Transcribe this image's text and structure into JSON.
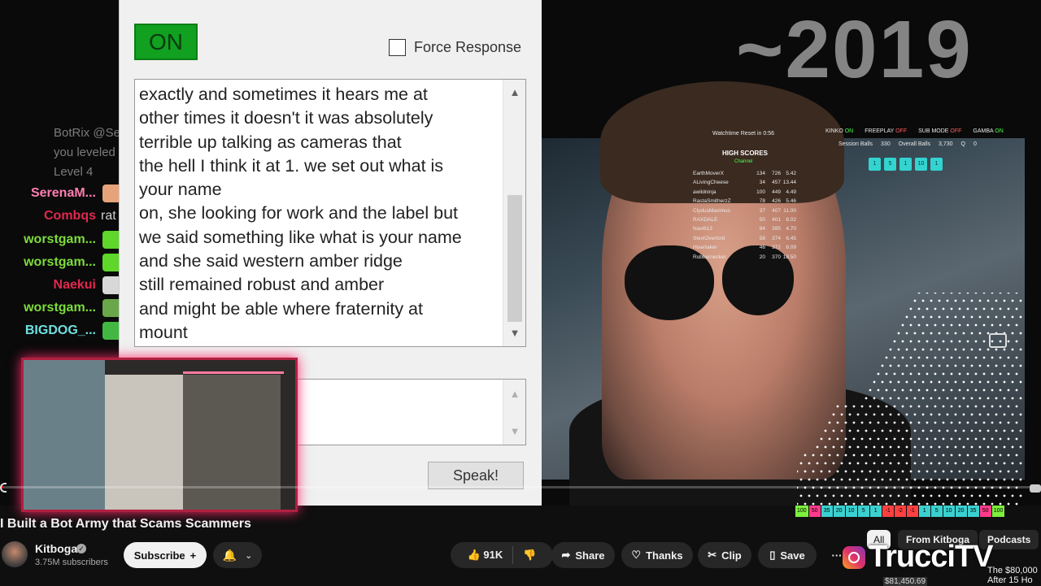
{
  "overlay": {
    "year": "~2019",
    "watchtime": "Watchtime Reset in 0:56",
    "modes": [
      {
        "label": "KINKO",
        "state": "ON"
      },
      {
        "label": "FREEPLAY",
        "state": "OFF"
      },
      {
        "label": "SUB MODE",
        "state": "OFF"
      },
      {
        "label": "GAMBA",
        "state": "ON"
      }
    ],
    "balls": {
      "session_label": "Session Balls",
      "session": "330",
      "overall_label": "Overall Balls",
      "overall": "3,730",
      "q_label": "Q",
      "q": "0"
    },
    "ball_boxes": [
      "1",
      "5",
      "1",
      "10",
      "1"
    ],
    "high_scores_title": "HIGH SCORES",
    "high_scores_sub": "Channel",
    "high_scores": [
      [
        "EarthMoverX",
        "134",
        "726",
        "5.42"
      ],
      [
        "ALivingCheese",
        "34",
        "457",
        "13.44"
      ],
      [
        "awildninja",
        "100",
        "449",
        "4.49"
      ],
      [
        "RastaSmitherzZ",
        "78",
        "426",
        "5.46"
      ],
      [
        "ClydusMaximus",
        "37",
        "407",
        "11.00"
      ],
      [
        "RAXDALE",
        "50",
        "401",
        "8.02"
      ],
      [
        "Navi613",
        "84",
        "395",
        "4.70"
      ],
      [
        "SteviOverlord",
        "58",
        "374",
        "6.45"
      ],
      [
        "Hisertaker",
        "46",
        "372",
        "8.09"
      ],
      [
        "Rubbernecker",
        "20",
        "370",
        "18.50"
      ]
    ],
    "meter": [
      {
        "v": "100",
        "c": "#7cf03c"
      },
      {
        "v": "50",
        "c": "#ff3b8b"
      },
      {
        "v": "35",
        "c": "#3ad0d0"
      },
      {
        "v": "20",
        "c": "#3ad0d0"
      },
      {
        "v": "10",
        "c": "#3ad0d0"
      },
      {
        "v": "5",
        "c": "#3ad0d0"
      },
      {
        "v": "1",
        "c": "#3ad0d0"
      },
      {
        "v": "-1",
        "c": "#ff4040"
      },
      {
        "v": "-2",
        "c": "#ff4040"
      },
      {
        "v": "-1",
        "c": "#ff4040"
      },
      {
        "v": "1",
        "c": "#3ad0d0"
      },
      {
        "v": "5",
        "c": "#3ad0d0"
      },
      {
        "v": "10",
        "c": "#3ad0d0"
      },
      {
        "v": "20",
        "c": "#3ad0d0"
      },
      {
        "v": "35",
        "c": "#3ad0d0"
      },
      {
        "v": "50",
        "c": "#ff3b8b"
      },
      {
        "v": "100",
        "c": "#7cf03c"
      }
    ]
  },
  "chat": {
    "ghost_lines": [
      "BotRix @SerenaMegami",
      "you leveled up to",
      "Level 4"
    ],
    "rows": [
      {
        "user": "SerenaM...",
        "color": "#ff7fb0",
        "emote": "#e6a37a",
        "text": ""
      },
      {
        "user": "Combqs",
        "color": "#e0284e",
        "emote": "",
        "text": "rat"
      },
      {
        "user": "worstgam...",
        "color": "#7ddc3c",
        "emote": "#5ed62a",
        "text": ""
      },
      {
        "user": "worstgam...",
        "color": "#7ddc3c",
        "emote": "#5ed62a",
        "text": ""
      },
      {
        "user": "Naekui",
        "color": "#e0284e",
        "emote": "#d8d8d8",
        "text": ""
      },
      {
        "user": "worstgam...",
        "color": "#7ddc3c",
        "emote": "#6aa64a",
        "text": ""
      },
      {
        "user": "BIGDOG_...",
        "color": "#6ee0e0",
        "emote": "#42b842",
        "text": ""
      }
    ]
  },
  "app": {
    "on_label": "ON",
    "force_label": "Force Response",
    "transcript": "exactly and sometimes it hears me at\nother times it doesn't it was absolutely\nterrible up talking as cameras that\nthe hell I think it at 1. we set out what is\nyour name\non, she looking for work and the label but\nwe said something like what is your name\nand she said western amber ridge\nstill remained robust and amber\nand might be able where fraternity at\nmount",
    "speak_label": "Speak!"
  },
  "video": {
    "title": "I Built a Bot Army that Scams Scammers",
    "channel": "Kitboga",
    "subscribers": "3.75M subscribers",
    "subscribe_label": "Subscribe",
    "likes": "91K",
    "share_label": "Share",
    "thanks_label": "Thanks",
    "clip_label": "Clip",
    "save_label": "Save",
    "chips": [
      "All",
      "From Kitboga",
      "Podcasts"
    ],
    "watermark": "TrucciTV",
    "price_tag": "$81,450.69",
    "rec_title": "The $80,000\nAfter 15 Ho"
  }
}
